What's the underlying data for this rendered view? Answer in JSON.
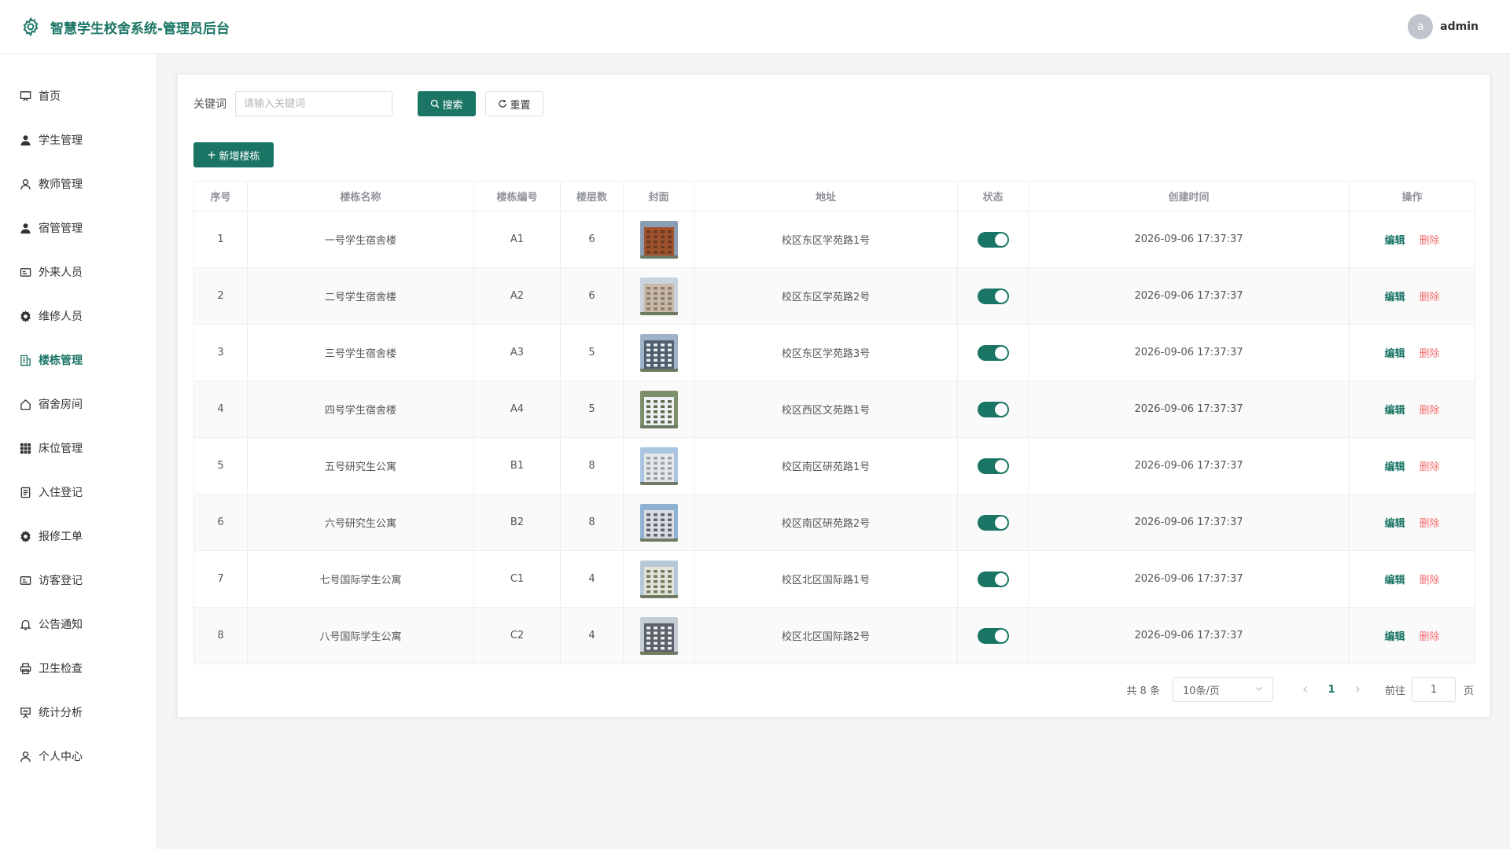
{
  "header": {
    "title": "智慧学生校舍系统-管理员后台",
    "avatar_letter": "a",
    "username": "admin"
  },
  "sidebar": {
    "items": [
      {
        "label": "首页",
        "icon": "home-icon"
      },
      {
        "label": "学生管理",
        "icon": "user-filled-icon"
      },
      {
        "label": "教师管理",
        "icon": "user-icon"
      },
      {
        "label": "宿管管理",
        "icon": "user-filled-icon"
      },
      {
        "label": "外来人员",
        "icon": "id-card-icon"
      },
      {
        "label": "维修人员",
        "icon": "gear-icon"
      },
      {
        "label": "楼栋管理",
        "icon": "building-icon",
        "active": true
      },
      {
        "label": "宿舍房间",
        "icon": "house-icon"
      },
      {
        "label": "床位管理",
        "icon": "grid-icon"
      },
      {
        "label": "入住登记",
        "icon": "document-icon"
      },
      {
        "label": "报修工单",
        "icon": "gear-icon"
      },
      {
        "label": "访客登记",
        "icon": "id-card-icon"
      },
      {
        "label": "公告通知",
        "icon": "bell-icon"
      },
      {
        "label": "卫生检查",
        "icon": "printer-icon"
      },
      {
        "label": "统计分析",
        "icon": "presentation-icon"
      },
      {
        "label": "个人中心",
        "icon": "user-icon"
      }
    ]
  },
  "search": {
    "label": "关键词",
    "placeholder": "请输入关键词",
    "search_label": "搜索",
    "reset_label": "重置"
  },
  "toolbar": {
    "add_label": "新增楼栋"
  },
  "table": {
    "headers": [
      "序号",
      "楼栋名称",
      "楼栋编号",
      "楼层数",
      "封面",
      "地址",
      "状态",
      "创建时间",
      "操作"
    ],
    "edit_label": "编辑",
    "delete_label": "删除",
    "rows": [
      {
        "no": "1",
        "name": "一号学生宿舍楼",
        "code": "A1",
        "floors": "6",
        "address": "校区东区学苑路1号",
        "status_on": true,
        "created": "2026-09-06 17:37:37"
      },
      {
        "no": "2",
        "name": "二号学生宿舍楼",
        "code": "A2",
        "floors": "6",
        "address": "校区东区学苑路2号",
        "status_on": true,
        "created": "2026-09-06 17:37:37"
      },
      {
        "no": "3",
        "name": "三号学生宿舍楼",
        "code": "A3",
        "floors": "5",
        "address": "校区东区学苑路3号",
        "status_on": true,
        "created": "2026-09-06 17:37:37"
      },
      {
        "no": "4",
        "name": "四号学生宿舍楼",
        "code": "A4",
        "floors": "5",
        "address": "校区西区文苑路1号",
        "status_on": true,
        "created": "2026-09-06 17:37:37"
      },
      {
        "no": "5",
        "name": "五号研究生公寓",
        "code": "B1",
        "floors": "8",
        "address": "校区南区研苑路1号",
        "status_on": true,
        "created": "2026-09-06 17:37:37"
      },
      {
        "no": "6",
        "name": "六号研究生公寓",
        "code": "B2",
        "floors": "8",
        "address": "校区南区研苑路2号",
        "status_on": true,
        "created": "2026-09-06 17:37:37"
      },
      {
        "no": "7",
        "name": "七号国际学生公寓",
        "code": "C1",
        "floors": "4",
        "address": "校区北区国际路1号",
        "status_on": true,
        "created": "2026-09-06 17:37:37"
      },
      {
        "no": "8",
        "name": "八号国际学生公寓",
        "code": "C2",
        "floors": "4",
        "address": "校区北区国际路2号",
        "status_on": true,
        "created": "2026-09-06 17:37:37"
      }
    ]
  },
  "pagination": {
    "total_text": "共 8 条",
    "page_size": "10条/页",
    "current_page": "1",
    "goto_label": "前往",
    "goto_value": "1",
    "page_unit": "页"
  },
  "colors": {
    "accent": "#1a7565",
    "danger": "#f56c6c"
  }
}
